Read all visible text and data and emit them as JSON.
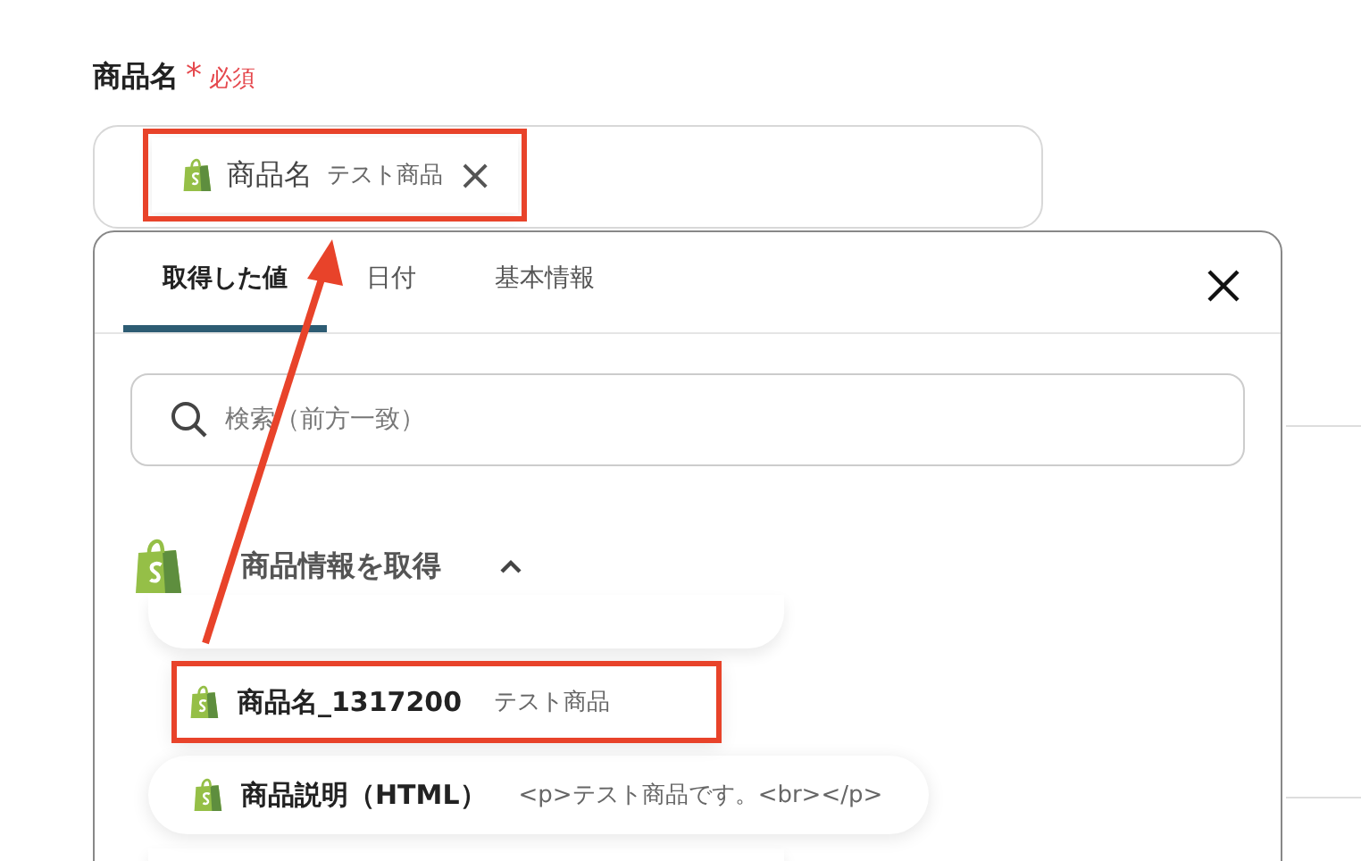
{
  "field": {
    "label": "商品名",
    "required_mark": "*",
    "required": "必須",
    "chip": {
      "name": "商品名",
      "value": "テスト商品",
      "remove": "×",
      "highlighted": true
    }
  },
  "popup": {
    "tabs": [
      {
        "label": "取得した値",
        "selected": true
      },
      {
        "label": "日付",
        "selected": false
      },
      {
        "label": "基本情報",
        "selected": false
      }
    ],
    "search": {
      "placeholder": "検索（前方一致）"
    },
    "group": {
      "title": "商品情報を取得",
      "expanded": true,
      "items": [
        {
          "kind": "partial"
        },
        {
          "kind": "item",
          "name": "商品名_1317200",
          "value": "テスト商品",
          "highlighted": true
        },
        {
          "kind": "item",
          "name": "商品説明（HTML）",
          "value": "<p>テスト商品です。<br></p>",
          "highlighted": false
        },
        {
          "kind": "partial"
        }
      ]
    }
  }
}
